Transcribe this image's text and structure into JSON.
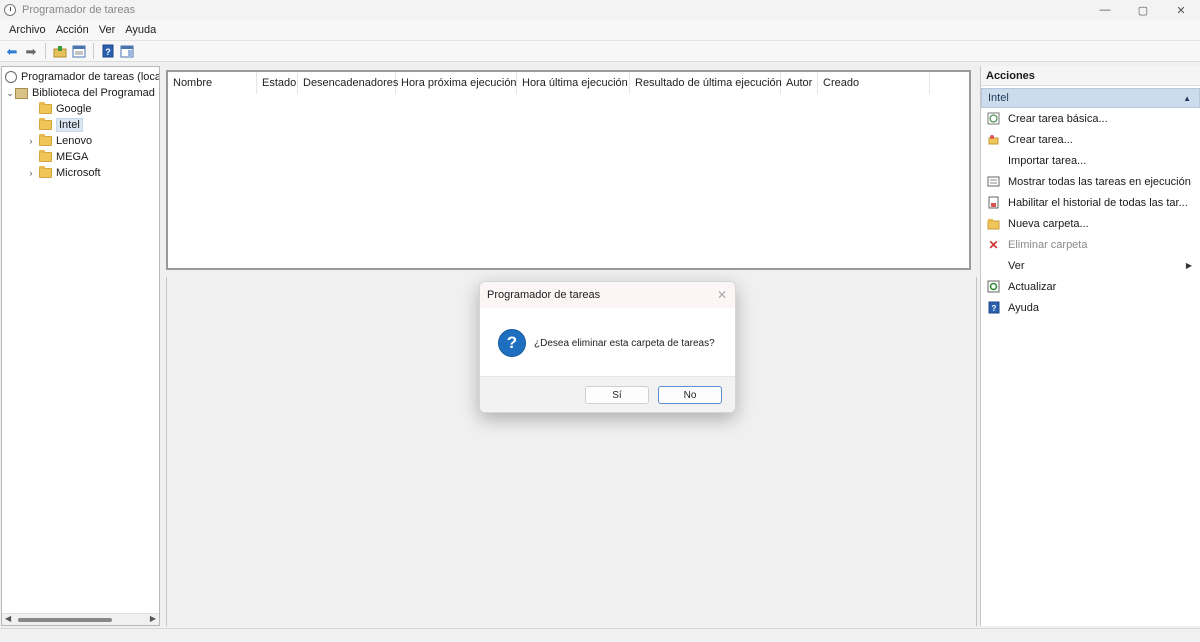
{
  "window": {
    "title": "Programador de tareas",
    "controls": {
      "minimize": "—",
      "maximize": "▢",
      "close": "✕"
    }
  },
  "menu": [
    "Archivo",
    "Acción",
    "Ver",
    "Ayuda"
  ],
  "toolbar": {
    "back_icon": "back-arrow-icon",
    "forward_icon": "forward-arrow-icon"
  },
  "tree": {
    "root": "Programador de tareas (local",
    "library": "Biblioteca del Programad",
    "folders": [
      "Google",
      "Intel",
      "Lenovo",
      "MEGA",
      "Microsoft"
    ],
    "selected": "Intel"
  },
  "task_list": {
    "columns": [
      "Nombre",
      "Estado",
      "Desencadenadores",
      "Hora próxima ejecución",
      "Hora última ejecución",
      "Resultado de última ejecución",
      "Autor",
      "Creado"
    ]
  },
  "actions": {
    "title": "Acciones",
    "group": "Intel",
    "items": [
      "Crear tarea básica...",
      "Crear tarea...",
      "Importar tarea...",
      "Mostrar todas las tareas en ejecución",
      "Habilitar el historial de todas las tar...",
      "Nueva carpeta...",
      "Eliminar carpeta",
      "Ver",
      "Actualizar",
      "Ayuda"
    ]
  },
  "dialog": {
    "title": "Programador de tareas",
    "message": "¿Desea eliminar esta carpeta de tareas?",
    "yes_label": "Sí",
    "no_label": "No"
  }
}
